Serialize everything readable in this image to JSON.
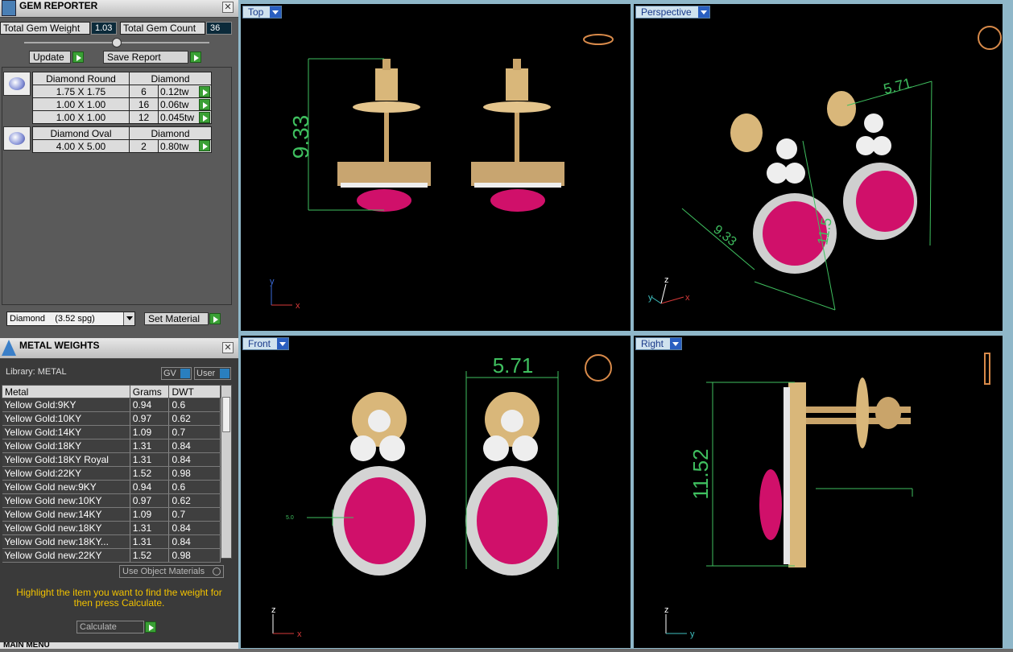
{
  "gem_reporter": {
    "title": "GEM REPORTER",
    "total_weight_label": "Total Gem Weight",
    "total_weight_value": "1.03",
    "total_count_label": "Total Gem Count",
    "total_count_value": "36",
    "update_label": "Update",
    "save_label": "Save Report",
    "groups": [
      {
        "name": "Diamond Round",
        "material": "Diamond",
        "rows": [
          {
            "size": "1.75 X 1.75",
            "count": "6",
            "weight": "0.12tw"
          },
          {
            "size": "1.00 X 1.00",
            "count": "16",
            "weight": "0.06tw"
          },
          {
            "size": "1.00 X 1.00",
            "count": "12",
            "weight": "0.045tw"
          }
        ]
      },
      {
        "name": "Diamond Oval",
        "material": "Diamond",
        "rows": [
          {
            "size": "4.00 X 5.00",
            "count": "2",
            "weight": "0.80tw"
          }
        ]
      }
    ],
    "material_select": "Diamond    (3.52 spg)",
    "set_material_label": "Set Material"
  },
  "metal_weights": {
    "title": "METAL WEIGHTS",
    "library_label": "Library: METAL",
    "gv_label": "GV",
    "user_label": "User",
    "columns": [
      "Metal",
      "Grams",
      "DWT"
    ],
    "rows": [
      [
        "Yellow Gold:9KY",
        "0.94",
        "0.6"
      ],
      [
        "Yellow Gold:10KY",
        "0.97",
        "0.62"
      ],
      [
        "Yellow Gold:14KY",
        "1.09",
        "0.7"
      ],
      [
        "Yellow Gold:18KY",
        "1.31",
        "0.84"
      ],
      [
        "Yellow Gold:18KY Royal",
        "1.31",
        "0.84"
      ],
      [
        "Yellow Gold:22KY",
        "1.52",
        "0.98"
      ],
      [
        "Yellow Gold new:9KY",
        "0.94",
        "0.6"
      ],
      [
        "Yellow Gold new:10KY",
        "0.97",
        "0.62"
      ],
      [
        "Yellow Gold new:14KY",
        "1.09",
        "0.7"
      ],
      [
        "Yellow Gold new:18KY",
        "1.31",
        "0.84"
      ],
      [
        "Yellow Gold new:18KY...",
        "1.31",
        "0.84"
      ],
      [
        "Yellow Gold new:22KY",
        "1.52",
        "0.98"
      ]
    ],
    "use_object_materials": "Use Object Materials",
    "hint": "Highlight the item you want to find the weight for then press Calculate.",
    "calculate_label": "Calculate",
    "main_menu_label": "MAIN MENU"
  },
  "viewports": {
    "top": {
      "label": "Top",
      "dim": "9.33"
    },
    "perspective": {
      "label": "Perspective",
      "dim_a": "5.71",
      "dim_b": "9.33",
      "dim_c": "11.5"
    },
    "front": {
      "label": "Front",
      "dim": "5.71",
      "small": "5.0"
    },
    "right": {
      "label": "Right",
      "dim": "11.52"
    },
    "axes": {
      "x": "x",
      "y": "y",
      "z": "z"
    }
  },
  "colors": {
    "dimension": "#3fbf5f",
    "ruby": "#d0106a",
    "gold": "#d9b77a",
    "accent": "#f2c200"
  }
}
